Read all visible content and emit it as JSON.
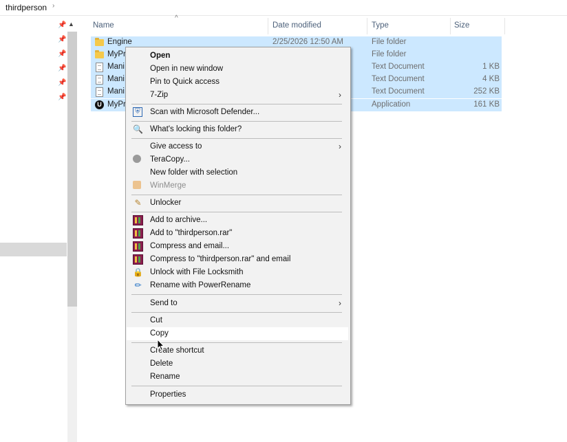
{
  "breadcrumb": {
    "folder": "thirdperson"
  },
  "columns": {
    "name": "Name",
    "date": "Date modified",
    "type": "Type",
    "size": "Size"
  },
  "files": [
    {
      "name": "Engine",
      "date": "2/25/2026 12:50 AM",
      "type": "File folder",
      "size": "",
      "icon": "folder-icon"
    },
    {
      "name": "MyPr",
      "date": "",
      "type": "File folder",
      "size": "",
      "icon": "folder-icon"
    },
    {
      "name": "Mani",
      "date": "",
      "type": "Text Document",
      "size": "1 KB",
      "icon": "text-file-icon"
    },
    {
      "name": "Mani",
      "date": "",
      "type": "Text Document",
      "size": "4 KB",
      "icon": "text-file-icon"
    },
    {
      "name": "Mani",
      "date": "",
      "type": "Text Document",
      "size": "252 KB",
      "icon": "text-file-icon"
    },
    {
      "name": "MyPr",
      "date": "",
      "type": "Application",
      "size": "161 KB",
      "icon": "unreal-engine-icon"
    }
  ],
  "menu": {
    "open": "Open",
    "open_new_window": "Open in new window",
    "pin_quick_access": "Pin to Quick access",
    "seven_zip": "7-Zip",
    "scan_defender": "Scan with Microsoft Defender...",
    "whats_locking": "What's locking this folder?",
    "give_access": "Give access to",
    "teracopy": "TeraCopy...",
    "new_folder_selection": "New folder with selection",
    "winmerge": "WinMerge",
    "unlocker": "Unlocker",
    "add_archive": "Add to archive...",
    "add_rar": "Add to \"thirdperson.rar\"",
    "compress_email": "Compress and email...",
    "compress_rar_email": "Compress to \"thirdperson.rar\" and email",
    "unlock_locksmith": "Unlock with File Locksmith",
    "power_rename": "Rename with PowerRename",
    "send_to": "Send to",
    "cut": "Cut",
    "copy": "Copy",
    "create_shortcut": "Create shortcut",
    "delete": "Delete",
    "rename": "Rename",
    "properties": "Properties"
  },
  "colors": {
    "selection": "#cce8ff",
    "menu_bg": "#f2f2f2",
    "menu_highlight": "#ffffff"
  }
}
